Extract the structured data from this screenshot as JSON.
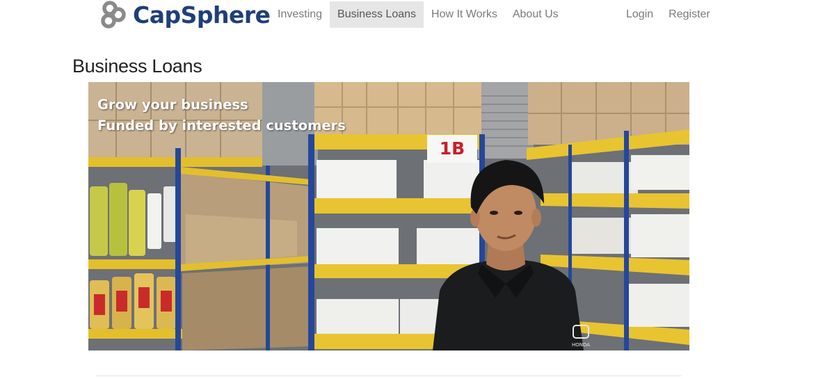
{
  "brand": {
    "name": "CapSphere"
  },
  "nav": {
    "items": [
      {
        "label": "Investing",
        "active": false
      },
      {
        "label": "Business Loans",
        "active": true
      },
      {
        "label": "How It Works",
        "active": false
      },
      {
        "label": "About Us",
        "active": false
      }
    ],
    "right": [
      {
        "label": "Login"
      },
      {
        "label": "Register"
      }
    ]
  },
  "page": {
    "title": "Business Loans"
  },
  "hero": {
    "line1": "Grow your business",
    "line2": "Funded by interested customers",
    "shelf_label": "1B",
    "shirt_logo": "HONDA"
  },
  "colors": {
    "brand": "#1f3f77",
    "nav_text": "#7a7a7a",
    "nav_active_bg": "#e6e6e6",
    "shelf_yellow": "#e8c431",
    "upright_blue": "#24479a",
    "shelf_label_red": "#c8202a"
  }
}
